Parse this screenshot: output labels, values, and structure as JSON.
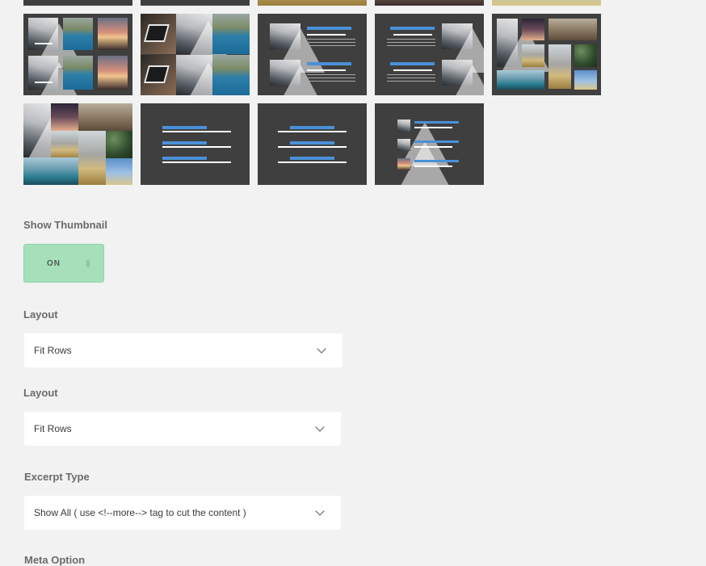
{
  "layouts_grid": {
    "selected": "",
    "items": [
      {
        "name": "layout-1"
      },
      {
        "name": "layout-2"
      },
      {
        "name": "layout-3"
      },
      {
        "name": "layout-4"
      },
      {
        "name": "layout-5"
      },
      {
        "name": "layout-6"
      },
      {
        "name": "layout-7"
      },
      {
        "name": "layout-8"
      },
      {
        "name": "layout-9"
      },
      {
        "name": "layout-10"
      },
      {
        "name": "layout-11"
      },
      {
        "name": "layout-12"
      },
      {
        "name": "layout-13"
      },
      {
        "name": "layout-14"
      }
    ]
  },
  "show_thumbnail": {
    "label": "Show Thumbnail",
    "toggle_text": "ON",
    "grip": "|||",
    "state": true,
    "color": "#a6e0bb"
  },
  "layout_1": {
    "label": "Layout",
    "value": "Fit Rows"
  },
  "layout_2": {
    "label": "Layout",
    "value": "Fit Rows"
  },
  "excerpt_type": {
    "label": "Excerpt Type",
    "value": "Show All ( use <!--more--> tag to cut the content )"
  },
  "meta_option": {
    "label": "Meta Option"
  },
  "colors": {
    "background": "#f2f2f2",
    "thumb_bg": "#3f3f3f",
    "accent_blue": "#4a90d9",
    "select_bg": "#ffffff"
  }
}
